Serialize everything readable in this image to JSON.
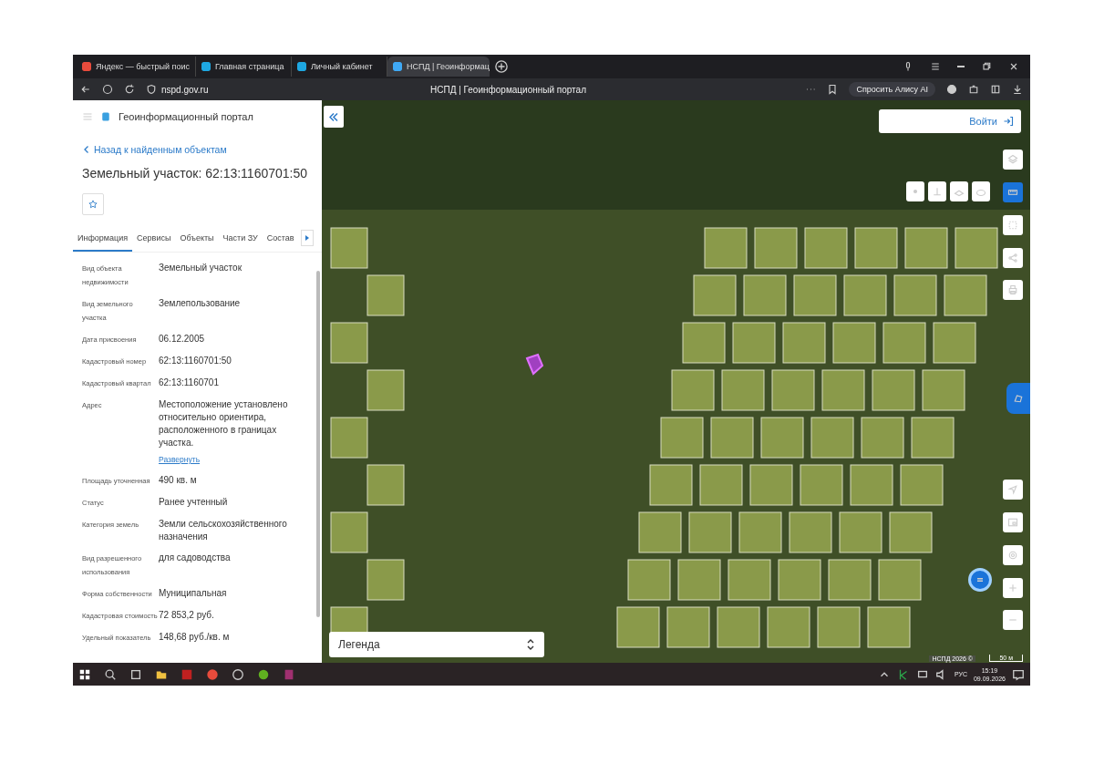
{
  "browser": {
    "tabs": [
      {
        "label": "Яндекс — быстрый поис",
        "selected": false
      },
      {
        "label": "Главная страница",
        "selected": false
      },
      {
        "label": "Личный кабинет",
        "selected": false
      },
      {
        "label": "НСПД | Геоинформац",
        "selected": true
      }
    ],
    "address": "nspd.gov.ru",
    "page_title": "НСПД | Геоинформационный портал",
    "ask_button": "Спросить Алису AI"
  },
  "sidebar": {
    "portal_title": "Геоинформационный портал",
    "back_link": "Назад к найденным объектам",
    "heading": "Земельный участок: 62:13:1160701:50",
    "tabs": [
      {
        "label": "Информация",
        "selected": true
      },
      {
        "label": "Сервисы",
        "selected": false
      },
      {
        "label": "Объекты",
        "selected": false
      },
      {
        "label": "Части ЗУ",
        "selected": false
      },
      {
        "label": "Состав",
        "selected": false
      }
    ],
    "fields": [
      {
        "label": "Вид объекта недвижимости",
        "value": "Земельный участок"
      },
      {
        "label": "Вид земельного участка",
        "value": "Землепользование"
      },
      {
        "label": "Дата присвоения",
        "value": "06.12.2005"
      },
      {
        "label": "Кадастровый номер",
        "value": "62:13:1160701:50"
      },
      {
        "label": "Кадастровый квартал",
        "value": "62:13:1160701"
      },
      {
        "label": "Адрес",
        "value": "Местоположение установлено относительно ориентира, расположенного в границах участка.",
        "expand_link": "Развернуть"
      },
      {
        "label": "Площадь уточненная",
        "value": "490 кв. м"
      },
      {
        "label": "Статус",
        "value": "Ранее учтенный"
      },
      {
        "label": "Категория земель",
        "value": "Земли сельскохозяйственного назначения"
      },
      {
        "label": "Вид разрешенного использования",
        "value": "для садоводства"
      },
      {
        "label": "Форма собственности",
        "value": "Муниципальная"
      },
      {
        "label": "Кадастровая стоимость",
        "value": "72 853,2 руб."
      },
      {
        "label": "Удельный показатель",
        "value": "148,68 руб./кв. м"
      }
    ]
  },
  "map": {
    "login_button": "Войти",
    "measure_active": true,
    "legend": "Легенда",
    "attribution": "НСПД 2026 ©",
    "scale": "50 м"
  },
  "taskbar": {
    "language": "РУС",
    "time": "15:19",
    "date": "09.09.2026"
  }
}
